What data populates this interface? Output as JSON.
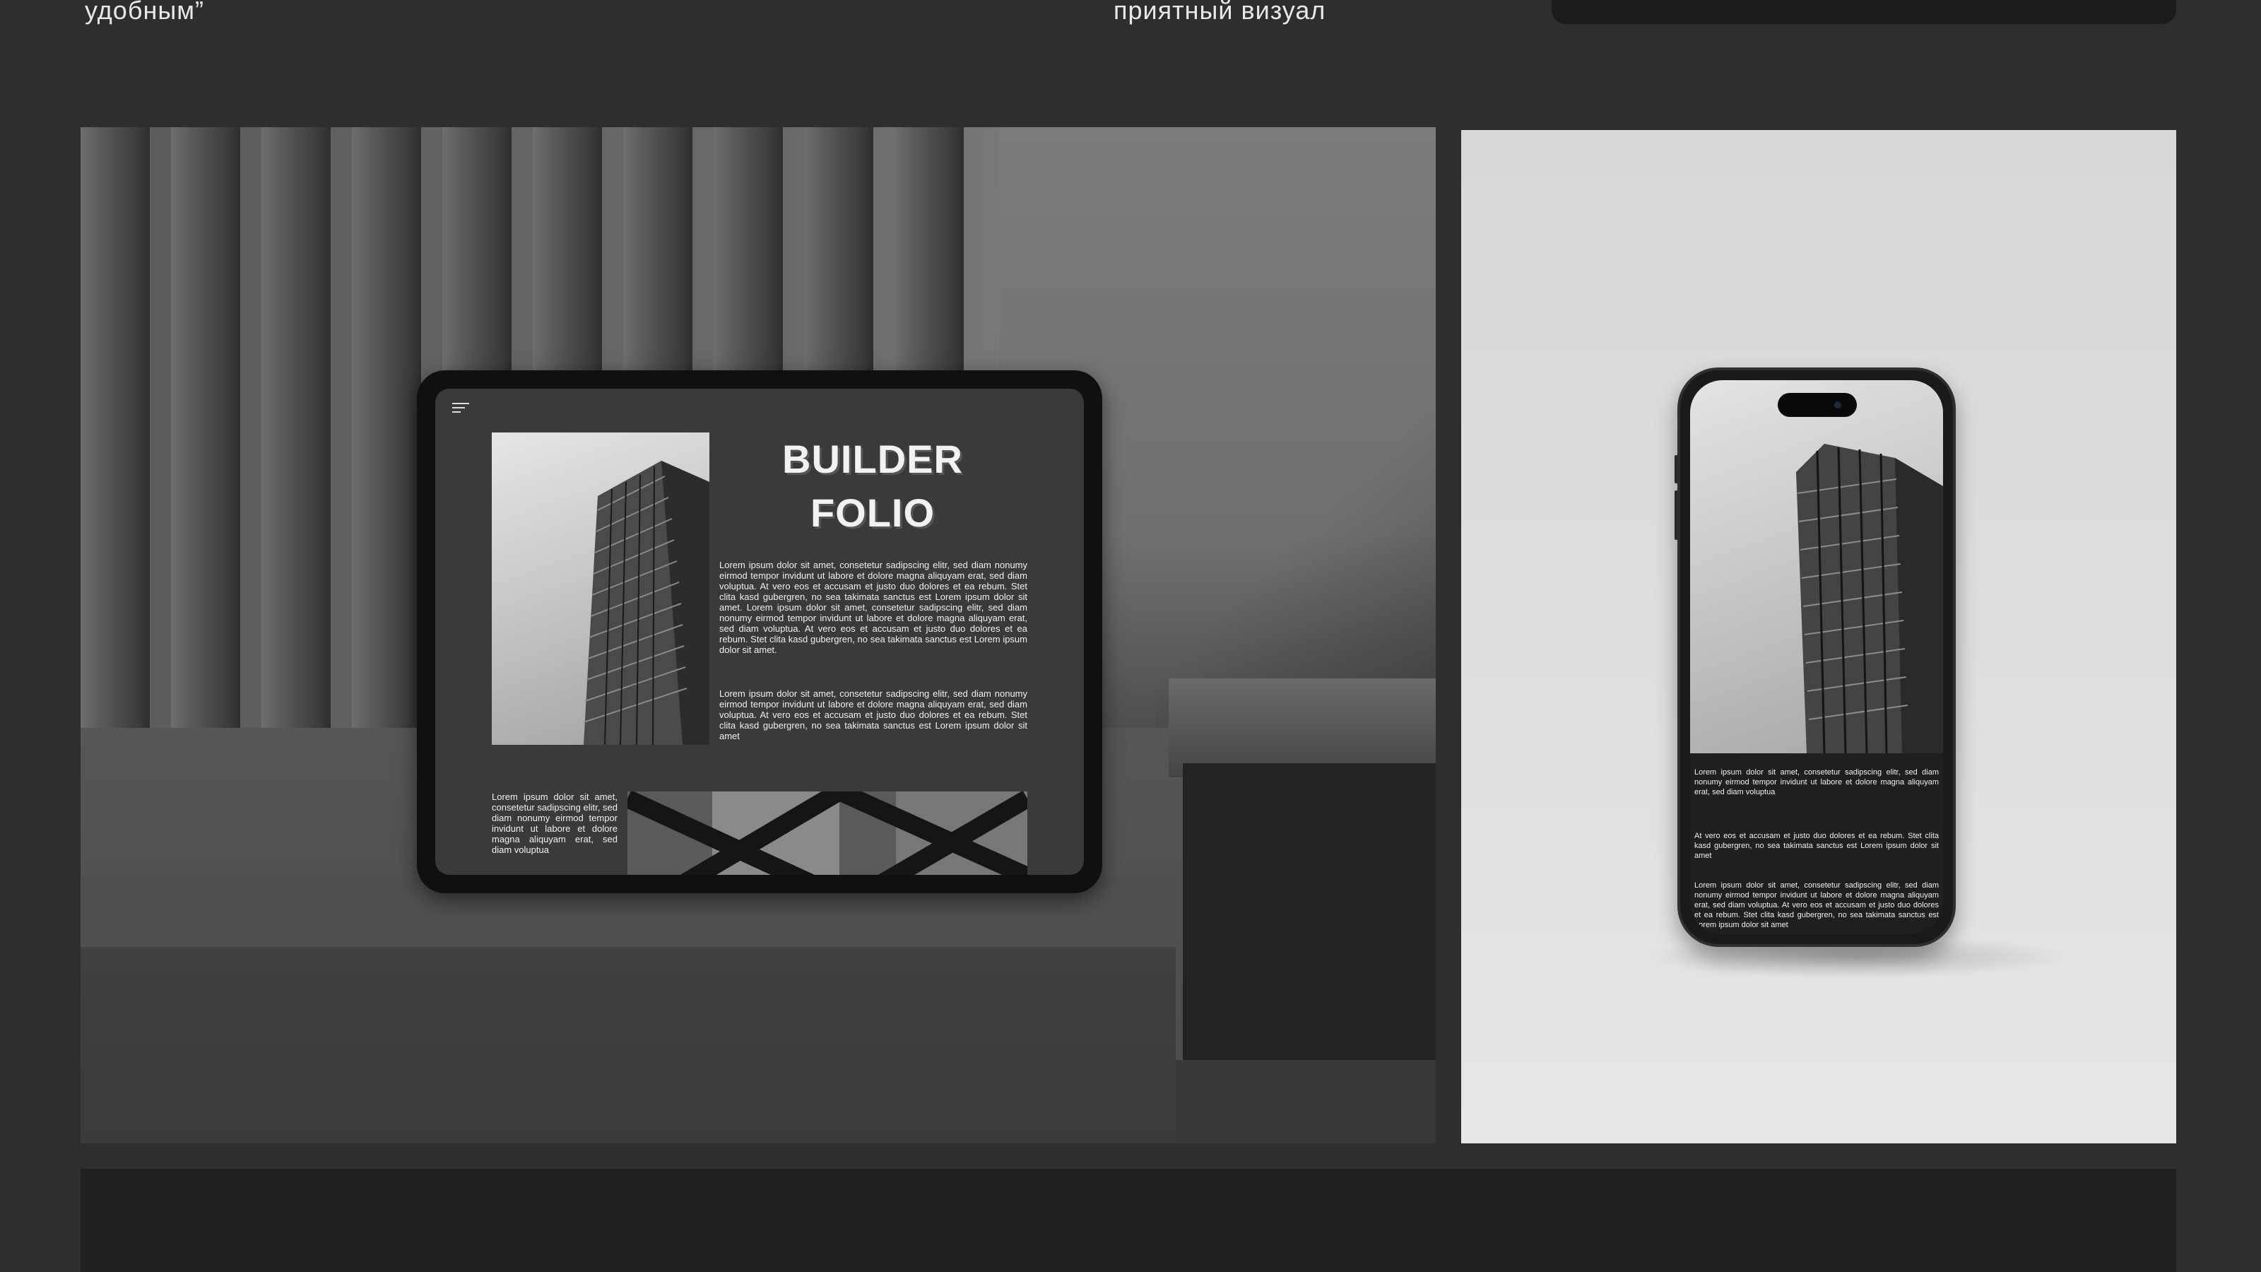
{
  "header": {
    "left_text": "удобным”",
    "middle_text": "приятный визуал"
  },
  "tablet": {
    "title_line1": "BUILDER",
    "title_line2": "FOLIO",
    "paragraph1": "Lorem ipsum dolor sit amet, consetetur sadipscing elitr, sed diam nonumy eirmod tempor invidunt ut labore et dolore magna aliquyam erat, sed diam voluptua. At vero eos et accusam et justo duo dolores et ea rebum. Stet clita kasd gubergren, no sea takimata sanctus est Lorem ipsum dolor sit amet. Lorem ipsum dolor sit amet, consetetur sadipscing elitr, sed diam nonumy eirmod tempor invidunt ut labore et dolore magna aliquyam erat, sed diam voluptua. At vero eos et accusam et justo duo dolores et ea rebum. Stet clita kasd gubergren, no sea takimata sanctus est Lorem ipsum dolor sit amet.",
    "paragraph2": "Lorem ipsum dolor sit amet, consetetur sadipscing elitr, sed diam nonumy eirmod tempor invidunt ut labore et dolore magna aliquyam erat, sed diam voluptua. At vero eos et accusam et justo duo dolores et ea rebum. Stet clita kasd gubergren, no sea takimata sanctus est Lorem ipsum dolor sit amet",
    "small_text": "Lorem ipsum dolor sit amet, consetetur sadipscing elitr, sed diam nonumy eirmod tempor invidunt ut labore et dolore magna aliquyam erat, sed diam voluptua"
  },
  "phone": {
    "paragraph1": "Lorem ipsum dolor sit amet, consetetur sadipscing elitr, sed diam nonumy eirmod tempor invidunt ut labore et dolore magna aliquyam erat, sed diam voluptua",
    "paragraph2": "At vero eos et accusam et justo duo dolores et ea rebum. Stet clita kasd gubergren, no sea takimata sanctus est Lorem ipsum dolor sit amet",
    "paragraph3": "Lorem ipsum dolor sit amet, consetetur sadipscing elitr, sed diam nonumy eirmod tempor invidunt ut labore et dolore magna aliquyam erat, sed diam voluptua. At vero eos et accusam et justo duo dolores et ea rebum. Stet clita kasd gubergren, no sea takimata sanctus est Lorem ipsum dolor sit amet"
  },
  "icons": {
    "menu": "hamburger-menu-icon"
  },
  "colors": {
    "page_background": "#2e2e2e",
    "screen_background": "#3a3a3a",
    "text_light": "#f0f0f0",
    "bottom_band": "#212121"
  }
}
